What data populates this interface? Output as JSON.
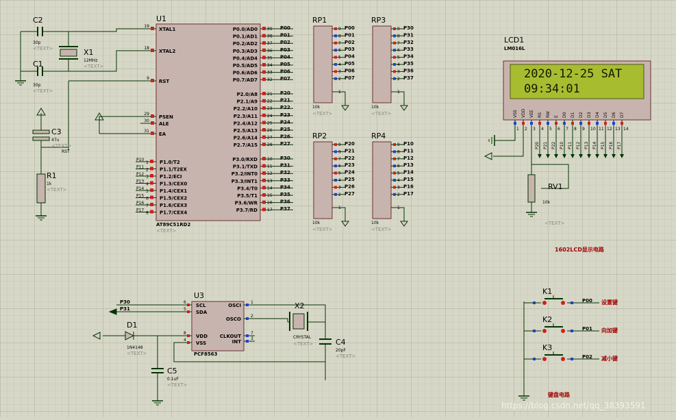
{
  "background_color": "#d7d7c7",
  "component_color": "#c8b4ae",
  "wire_color": "#003300",
  "lcd_bg_color": "#a8bc30",
  "caption_color": "#a00000",
  "components": {
    "u1": {
      "ref": "U1",
      "part": "AT89C51RD2",
      "text": "<TEXT>",
      "left_pins": [
        {
          "num": "19",
          "name": "XTAL1"
        },
        {
          "num": "18",
          "name": "XTAL2"
        },
        {
          "num": "9",
          "name": "RST"
        },
        {
          "num": "29",
          "name": "PSEN"
        },
        {
          "num": "30",
          "name": "ALE"
        },
        {
          "num": "31",
          "name": "EA"
        }
      ],
      "p1_pins": [
        {
          "net": "P10",
          "num": "1",
          "name": "P1.0/T2"
        },
        {
          "net": "P11",
          "num": "2",
          "name": "P1.1/T2EX"
        },
        {
          "net": "P12",
          "num": "3",
          "name": "P1.2/ECI"
        },
        {
          "net": "P13",
          "num": "4",
          "name": "P1.3/CEX0"
        },
        {
          "net": "P14",
          "num": "5",
          "name": "P1.4/CEX1"
        },
        {
          "net": "P15",
          "num": "6",
          "name": "P1.5/CEX2"
        },
        {
          "net": "P16",
          "num": "7",
          "name": "P1.6/CEX3"
        },
        {
          "net": "P17",
          "num": "8",
          "name": "P1.7/CEX4"
        }
      ],
      "p0_pins": [
        {
          "num": "39",
          "name": "P0.0/AD0",
          "net": "P00"
        },
        {
          "num": "38",
          "name": "P0.1/AD1",
          "net": "P01"
        },
        {
          "num": "37",
          "name": "P0.2/AD2",
          "net": "P02"
        },
        {
          "num": "36",
          "name": "P0.3/AD3",
          "net": "P03"
        },
        {
          "num": "35",
          "name": "P0.4/AD4",
          "net": "P04"
        },
        {
          "num": "34",
          "name": "P0.5/AD5",
          "net": "P05"
        },
        {
          "num": "33",
          "name": "P0.6/AD6",
          "net": "P06"
        },
        {
          "num": "32",
          "name": "P0.7/AD7",
          "net": "P07"
        }
      ],
      "p2_pins": [
        {
          "num": "21",
          "name": "P2.0/A8",
          "net": "P20"
        },
        {
          "num": "22",
          "name": "P2.1/A9",
          "net": "P21"
        },
        {
          "num": "23",
          "name": "P2.2/A10",
          "net": "P22"
        },
        {
          "num": "24",
          "name": "P2.3/A11",
          "net": "P23"
        },
        {
          "num": "25",
          "name": "P2.4/A12",
          "net": "P24"
        },
        {
          "num": "26",
          "name": "P2.5/A13",
          "net": "P25"
        },
        {
          "num": "27",
          "name": "P2.6/A14",
          "net": "P26"
        },
        {
          "num": "28",
          "name": "P2.7/A15",
          "net": "P27"
        }
      ],
      "p3_pins": [
        {
          "num": "10",
          "name": "P3.0/RXD",
          "net": "P30"
        },
        {
          "num": "11",
          "name": "P3.1/TXD",
          "net": "P31"
        },
        {
          "num": "12",
          "name": "P3.2/INT0",
          "net": "P32"
        },
        {
          "num": "13",
          "name": "P3.3/INT1",
          "net": "P33"
        },
        {
          "num": "14",
          "name": "P3.4/T0",
          "net": "P34"
        },
        {
          "num": "15",
          "name": "P3.5/T1",
          "net": "P35"
        },
        {
          "num": "16",
          "name": "P3.6/WR",
          "net": "P36"
        },
        {
          "num": "17",
          "name": "P3.7/RD",
          "net": "P37"
        }
      ]
    },
    "c2": {
      "ref": "C2",
      "value": "30p",
      "text": "<TEXT>"
    },
    "c1": {
      "ref": "C1",
      "value": "30p",
      "text": "<TEXT>"
    },
    "x1": {
      "ref": "X1",
      "value": "12MHz",
      "text": "<TEXT>"
    },
    "c3": {
      "ref": "C3",
      "value": "47u",
      "text": "<TEXT>"
    },
    "r1": {
      "ref": "R1",
      "value": "1k",
      "text": "<TEXT>"
    },
    "rst_label": "RST",
    "rp1": {
      "ref": "RP1",
      "value": "10k",
      "text": "<TEXT>",
      "nets": [
        "P00",
        "P01",
        "P02",
        "P03",
        "P04",
        "P05",
        "P06",
        "P07"
      ]
    },
    "rp2": {
      "ref": "RP2",
      "value": "10k",
      "text": "<TEXT>",
      "nets": [
        "P20",
        "P21",
        "P22",
        "P23",
        "P24",
        "P25",
        "P26",
        "P27"
      ]
    },
    "rp3": {
      "ref": "RP3",
      "value": "10k",
      "text": "<TEXT>",
      "nets": [
        "P30",
        "P31",
        "P32",
        "P33",
        "P34",
        "P35",
        "P36",
        "P37"
      ]
    },
    "rp4": {
      "ref": "RP4",
      "value": "10k",
      "text": "<TEXT>",
      "nets": [
        "P10",
        "P11",
        "P12",
        "P13",
        "P14",
        "P15",
        "P16",
        "P17"
      ]
    },
    "rp_pin_nums": [
      "9",
      "8",
      "7",
      "6",
      "5",
      "4",
      "3",
      "2"
    ],
    "rp_common_pin": "1",
    "lcd1": {
      "ref": "LCD1",
      "part": "LM016L",
      "line1": "2020-12-25 SAT",
      "line2": "09:34:01",
      "pins": [
        "VSS",
        "VDD",
        "VEE",
        "RS",
        "RW",
        "E",
        "D0",
        "D1",
        "D2",
        "D3",
        "D4",
        "D5",
        "D6",
        "D7"
      ],
      "pin_nums": [
        "1",
        "2",
        "3",
        "4",
        "5",
        "6",
        "7",
        "8",
        "9",
        "10",
        "11",
        "12",
        "13",
        "14"
      ],
      "nets": [
        "P20",
        "P21",
        "P22",
        "P10",
        "P11",
        "P12",
        "P13",
        "P14",
        "P15",
        "P16",
        "P17"
      ]
    },
    "rv1": {
      "ref": "RV1",
      "value": "10k",
      "text": "<TEXT>"
    },
    "lcd_caption": "1602LCD显示电路",
    "u3": {
      "ref": "U3",
      "part": "PCF8563",
      "left": [
        {
          "num": "6",
          "name": "SCL"
        },
        {
          "num": "5",
          "name": "SDA"
        },
        {
          "num": "8",
          "name": "VDD"
        },
        {
          "num": "4",
          "name": "VSS"
        }
      ],
      "right": [
        {
          "num": "1",
          "name": "OSCI"
        },
        {
          "num": "2",
          "name": "OSCO"
        },
        {
          "num": "7",
          "name": "CLKOUT"
        },
        {
          "num": "3",
          "name": "INT"
        }
      ],
      "nets": [
        "P30",
        "P31"
      ]
    },
    "x2": {
      "ref": "X2",
      "value": "CRYSTAL",
      "text": "<TEXT>"
    },
    "c4": {
      "ref": "C4",
      "value": "20pF",
      "text": "<TEXT>"
    },
    "d1": {
      "ref": "D1",
      "value": "1N4148",
      "text": "<TEXT>"
    },
    "c5": {
      "ref": "C5",
      "value": "0.1uF",
      "text": "<TEXT>"
    },
    "keys": [
      {
        "ref": "K1",
        "net": "P00",
        "label": "设置键"
      },
      {
        "ref": "K2",
        "net": "P01",
        "label": "向加键"
      },
      {
        "ref": "K3",
        "net": "P02",
        "label": "减小键"
      }
    ],
    "key_caption": "键盘电路",
    "watermark": "https://blog.csdn.net/qq_38393591"
  }
}
